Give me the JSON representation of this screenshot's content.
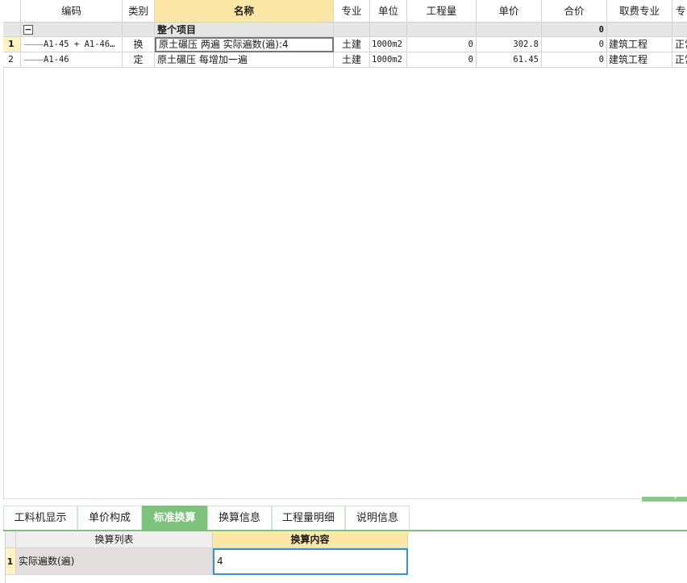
{
  "table": {
    "headers": [
      "编码",
      "类别",
      "名称",
      "专业",
      "单位",
      "工程量",
      "单价",
      "合价",
      "取费专业",
      "专"
    ],
    "group": {
      "toggle": "−",
      "name": "整个项目",
      "total": "0"
    },
    "rows": [
      {
        "index": "1",
        "code": "A1-45 + A1-46…",
        "type": "换",
        "name": "原土碾压 两遍  实际遍数(遍):4",
        "major": "土建",
        "unit": "1000m2",
        "qty": "0",
        "price": "302.8",
        "total": "0",
        "fee": "建筑工程",
        "extra": "正常"
      },
      {
        "index": "2",
        "code": "A1-46",
        "type": "定",
        "name": "原土碾压 每增加一遍",
        "major": "土建",
        "unit": "1000m2",
        "qty": "0",
        "price": "61.45",
        "total": "0",
        "fee": "建筑工程",
        "extra": "正常"
      }
    ]
  },
  "tabs": [
    "工料机显示",
    "单价构成",
    "标准换算",
    "换算信息",
    "工程量明细",
    "说明信息"
  ],
  "active_tab_index": 2,
  "conv": {
    "headers": [
      "换算列表",
      "换算内容"
    ],
    "rows": [
      {
        "index": "1",
        "label": "实际遍数(遍)",
        "value": "4"
      }
    ]
  },
  "colors": {
    "accent_green": "#7cc27a",
    "header_active": "#fde7a6",
    "row_marker": "#fff3c4",
    "group_bg": "#e6e6e6"
  }
}
